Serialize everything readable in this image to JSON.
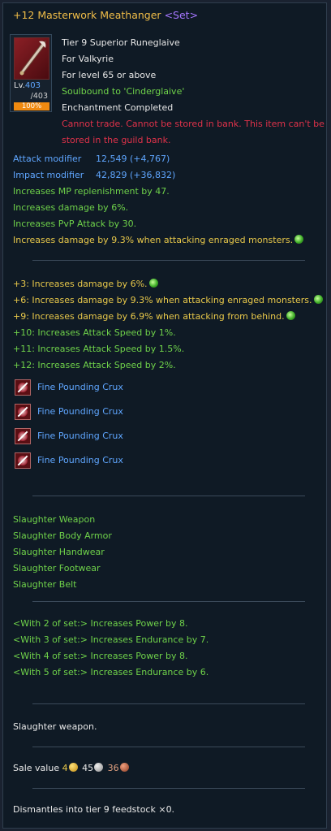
{
  "item": {
    "name": "+12 Masterwork Meathanger",
    "set_tag": "<Set>",
    "level_label": "Lv.",
    "level": "403",
    "level_max": "/403",
    "enchant_progress": 100,
    "enchant_progress_text": "100%",
    "info": [
      {
        "text": "Tier 9 Superior Runeglaive",
        "color": "white"
      },
      {
        "text": "For Valkyrie",
        "color": "white"
      },
      {
        "text": "For level 65 or above",
        "color": "white"
      },
      {
        "text": "Soulbound to 'Cinderglaive'",
        "color": "green"
      },
      {
        "text": "Enchantment Completed",
        "color": "white"
      },
      {
        "text": "Cannot trade. Cannot be stored in bank. This item can't be",
        "color": "red"
      },
      {
        "text": "stored in the guild bank.",
        "color": "red"
      }
    ]
  },
  "modifiers": [
    {
      "label": "Attack modifier",
      "value": "12,549 (+4,767)"
    },
    {
      "label": "Impact modifier",
      "value": "42,829 (+36,832)"
    }
  ],
  "base_stats": [
    {
      "text": "Increases MP replenishment by 47.",
      "color": "green"
    },
    {
      "text": "Increases damage by 6%.",
      "color": "green"
    },
    {
      "text": "Increases PvP Attack by 30.",
      "color": "green"
    },
    {
      "text": "Increases damage by 9.3% when attacking enraged monsters.",
      "color": "yellow",
      "gem": true
    }
  ],
  "enchant_bonuses": [
    {
      "text": "+3: Increases damage by 6%.",
      "color": "yellow",
      "gem": true
    },
    {
      "text": "+6: Increases damage by 9.3% when attacking enraged monsters.",
      "color": "yellow",
      "gem": true
    },
    {
      "text": "+9: Increases damage by 6.9% when attacking from behind.",
      "color": "yellow",
      "gem": true
    },
    {
      "text": "+10: Increases Attack Speed by 1%.",
      "color": "green"
    },
    {
      "text": "+11: Increases Attack Speed by 1.5%.",
      "color": "green"
    },
    {
      "text": "+12: Increases Attack Speed by 2%.",
      "color": "green"
    }
  ],
  "crystals": [
    "Fine Pounding Crux",
    "Fine Pounding Crux",
    "Fine Pounding Crux",
    "Fine Pounding Crux"
  ],
  "set_items": [
    "Slaughter Weapon",
    "Slaughter Body Armor",
    "Slaughter Handwear",
    "Slaughter Footwear",
    "Slaughter Belt"
  ],
  "set_bonuses": [
    "<With 2 of set:> Increases Power by 8.",
    "<With 3 of set:> Increases Endurance by 7.",
    "<With 4 of set:> Increases Power by 8.",
    "<With 5 of set:> Increases Endurance by 6."
  ],
  "description": "Slaughter weapon.",
  "sale": {
    "label": "Sale value",
    "gold": "4",
    "silver": "45",
    "copper": "36"
  },
  "dismantle": "Dismantles into tier 9 feedstock ×0.",
  "colors": {
    "title": "#f0bd48",
    "set": "#a576ff",
    "green": "#6fd24a",
    "yellow": "#e8c84a",
    "red": "#e0324a",
    "blue": "#5fa6ff",
    "white": "#e8e8e8",
    "progress": "#f08a10"
  }
}
